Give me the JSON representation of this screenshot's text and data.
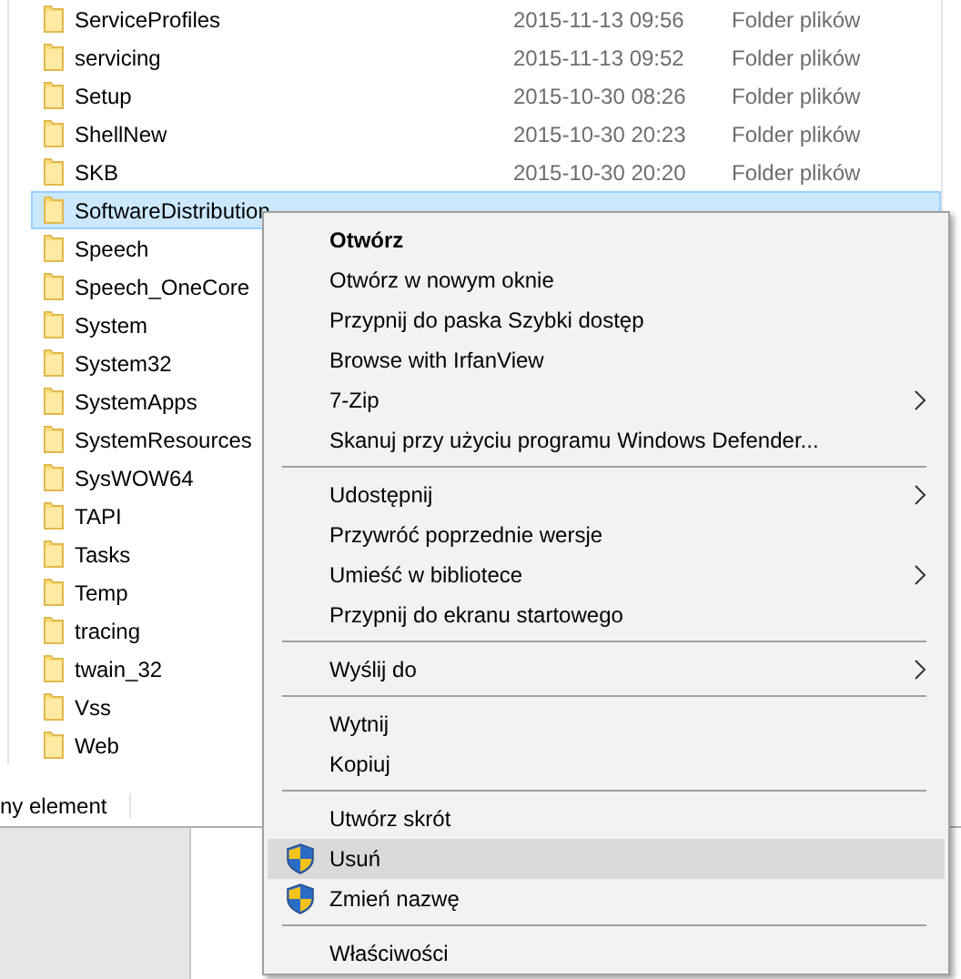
{
  "files": [
    {
      "name": "ServiceProfiles",
      "date": "2015-11-13 09:56",
      "type": "Folder plików",
      "selected": false
    },
    {
      "name": "servicing",
      "date": "2015-11-13 09:52",
      "type": "Folder plików",
      "selected": false
    },
    {
      "name": "Setup",
      "date": "2015-10-30 08:26",
      "type": "Folder plików",
      "selected": false
    },
    {
      "name": "ShellNew",
      "date": "2015-10-30 20:23",
      "type": "Folder plików",
      "selected": false
    },
    {
      "name": "SKB",
      "date": "2015-10-30 20:20",
      "type": "Folder plików",
      "selected": false
    },
    {
      "name": "SoftwareDistribution",
      "selected": true
    },
    {
      "name": "Speech",
      "selected": false
    },
    {
      "name": "Speech_OneCore",
      "selected": false
    },
    {
      "name": "System",
      "selected": false
    },
    {
      "name": "System32",
      "selected": false
    },
    {
      "name": "SystemApps",
      "selected": false
    },
    {
      "name": "SystemResources",
      "selected": false
    },
    {
      "name": "SysWOW64",
      "selected": false
    },
    {
      "name": "TAPI",
      "selected": false
    },
    {
      "name": "Tasks",
      "selected": false
    },
    {
      "name": "Temp",
      "selected": false
    },
    {
      "name": "tracing",
      "selected": false
    },
    {
      "name": "twain_32",
      "selected": false
    },
    {
      "name": "Vss",
      "selected": false
    },
    {
      "name": "Web",
      "selected": false
    }
  ],
  "status_bar": "ny element",
  "context_menu": [
    {
      "kind": "item",
      "label": "Otwórz",
      "bold": true,
      "submenu": false,
      "shield": false,
      "selected": false
    },
    {
      "kind": "item",
      "label": "Otwórz w nowym oknie",
      "bold": false,
      "submenu": false,
      "shield": false,
      "selected": false
    },
    {
      "kind": "item",
      "label": "Przypnij do paska Szybki dostęp",
      "bold": false,
      "submenu": false,
      "shield": false,
      "selected": false
    },
    {
      "kind": "item",
      "label": "Browse with IrfanView",
      "bold": false,
      "submenu": false,
      "shield": false,
      "selected": false
    },
    {
      "kind": "item",
      "label": "7-Zip",
      "bold": false,
      "submenu": true,
      "shield": false,
      "selected": false
    },
    {
      "kind": "item",
      "label": "Skanuj przy użyciu programu Windows Defender...",
      "bold": false,
      "submenu": false,
      "shield": false,
      "selected": false
    },
    {
      "kind": "separator"
    },
    {
      "kind": "item",
      "label": "Udostępnij",
      "bold": false,
      "submenu": true,
      "shield": false,
      "selected": false
    },
    {
      "kind": "item",
      "label": "Przywróć poprzednie wersje",
      "bold": false,
      "submenu": false,
      "shield": false,
      "selected": false
    },
    {
      "kind": "item",
      "label": "Umieść w bibliotece",
      "bold": false,
      "submenu": true,
      "shield": false,
      "selected": false
    },
    {
      "kind": "item",
      "label": "Przypnij do ekranu startowego",
      "bold": false,
      "submenu": false,
      "shield": false,
      "selected": false
    },
    {
      "kind": "separator"
    },
    {
      "kind": "item",
      "label": "Wyślij do",
      "bold": false,
      "submenu": true,
      "shield": false,
      "selected": false
    },
    {
      "kind": "separator"
    },
    {
      "kind": "item",
      "label": "Wytnij",
      "bold": false,
      "submenu": false,
      "shield": false,
      "selected": false
    },
    {
      "kind": "item",
      "label": "Kopiuj",
      "bold": false,
      "submenu": false,
      "shield": false,
      "selected": false
    },
    {
      "kind": "separator"
    },
    {
      "kind": "item",
      "label": "Utwórz skrót",
      "bold": false,
      "submenu": false,
      "shield": false,
      "selected": false
    },
    {
      "kind": "item",
      "label": "Usuń",
      "bold": false,
      "submenu": false,
      "shield": true,
      "selected": true
    },
    {
      "kind": "item",
      "label": "Zmień nazwę",
      "bold": false,
      "submenu": false,
      "shield": true,
      "selected": false
    },
    {
      "kind": "separator"
    },
    {
      "kind": "item",
      "label": "Właściwości",
      "bold": false,
      "submenu": false,
      "shield": false,
      "selected": false
    }
  ]
}
